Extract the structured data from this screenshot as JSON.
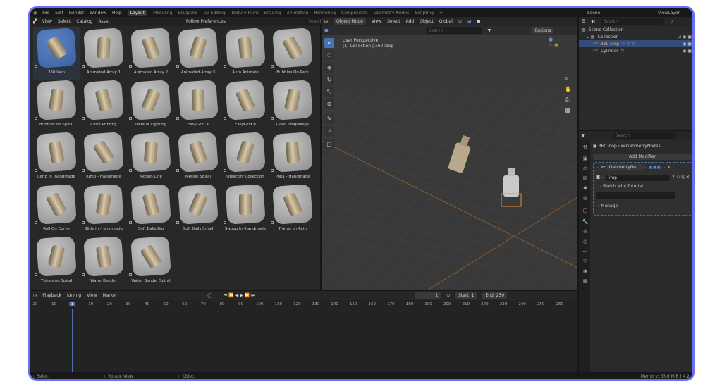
{
  "topbar": {
    "menus": [
      "File",
      "Edit",
      "Render",
      "Window",
      "Help"
    ],
    "workspaces": [
      "Layout",
      "Modeling",
      "Sculpting",
      "UV Editing",
      "Texture Paint",
      "Shading",
      "Animation",
      "Rendering",
      "Compositing",
      "Geometry Nodes",
      "Scripting"
    ],
    "add": "+",
    "scene": "Scene",
    "view_layer": "ViewLayer"
  },
  "asset_browser": {
    "menus": [
      "View",
      "Select",
      "Catalog",
      "Asset"
    ],
    "import_method": "Follow Preferences",
    "search_placeholder": "Search",
    "assets": [
      "360 loop",
      "Animated Array 1",
      "Animated Array 2",
      "Animated Array 3",
      "Auto Animate",
      "Bubbles On Path",
      "Bubbles on Spiral",
      "Cloth Printing",
      "Default  Lighting",
      "EasyGrid A",
      "EasyGrid B",
      "Good Shapekeys",
      "Jump in -handmade",
      "Jump - Handmade",
      "Motion Line",
      "Motion Spiral",
      "Objectify Collection",
      "Pop1 - Handmade",
      "Roll On Curve",
      "Slide in -Handmade",
      "Soft Balls Big",
      "Soft Balls Small",
      "Swoop in -handmade",
      "Things on Path",
      "Things on Spiral",
      "Water Bender",
      "Water Bender Spiral"
    ]
  },
  "viewport": {
    "mode": "Object Mode",
    "menus": [
      "View",
      "Select",
      "Add",
      "Object"
    ],
    "orientation": "Global",
    "search_placeholder": "Search",
    "options": "Options",
    "perspective": "User Perspective",
    "context": "(1) Collection | 360 loop"
  },
  "outliner": {
    "search_placeholder": "Search",
    "scene_collection": "Scene Collection",
    "collection": "Collection",
    "items": [
      "360 loop",
      "Cylinder"
    ]
  },
  "properties": {
    "search_placeholder": "Search",
    "object": "360 loop",
    "modifier_breadcrumb": "GeometryNodes",
    "add_modifier": "Add Modifier",
    "modifier_name": "GeometryNo...",
    "node_group": "imp",
    "users": "2",
    "panel_tutorial": "Watch Mini Tutorial",
    "panel_manage": "Manage"
  },
  "timeline": {
    "menus": [
      "Playback",
      "Keying",
      "View",
      "Marker"
    ],
    "current_frame": "1",
    "start_label": "Start",
    "start": "1",
    "end_label": "End",
    "end": "250",
    "ticks": [
      "-20",
      "-10",
      "1",
      "10",
      "20",
      "30",
      "40",
      "50",
      "60",
      "70",
      "80",
      "90",
      "100",
      "110",
      "120",
      "130",
      "140",
      "150",
      "160",
      "170",
      "180",
      "190",
      "200",
      "210",
      "220",
      "230",
      "240",
      "250",
      "260"
    ]
  },
  "statusbar": {
    "select": "Select",
    "rotate": "Rotate View",
    "object": "Object",
    "memory": "Memory: 33.6 MiB | 4.2"
  }
}
